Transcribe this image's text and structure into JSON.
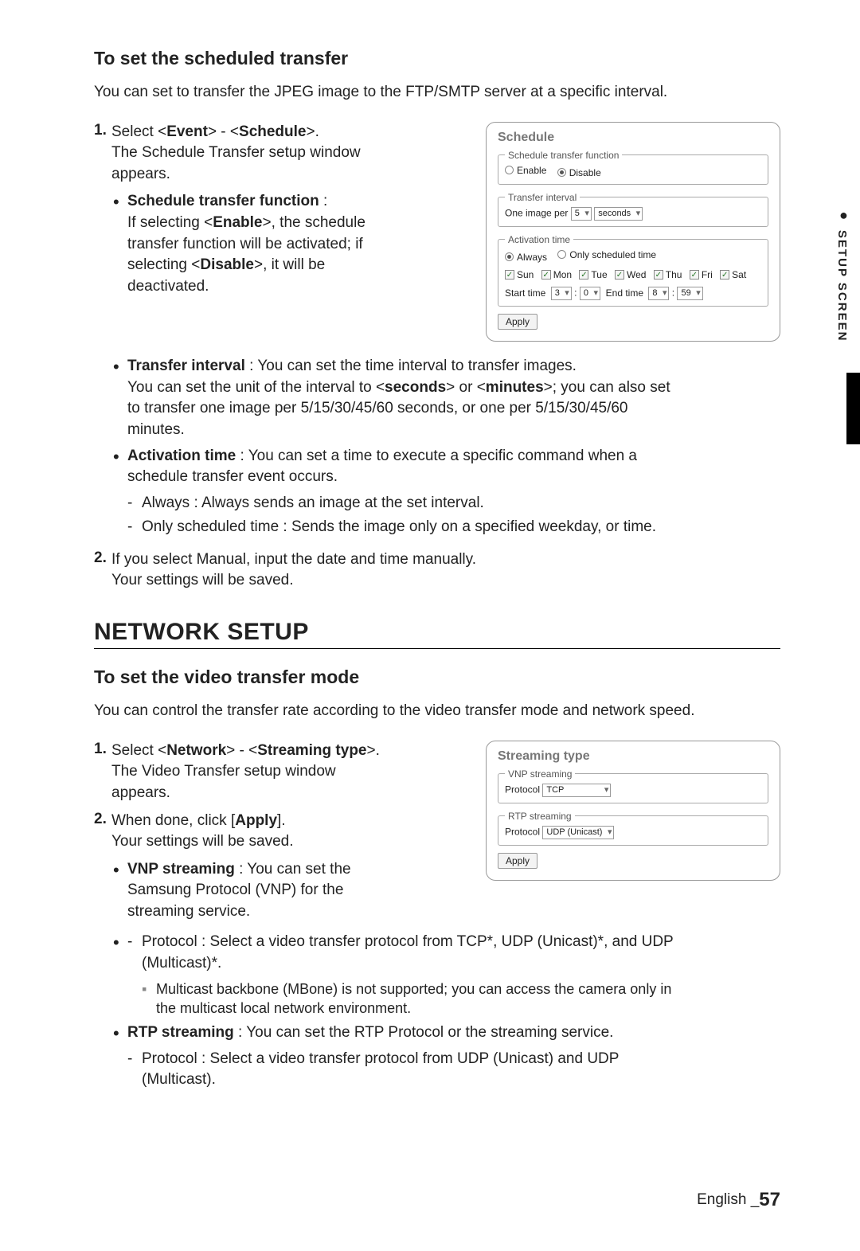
{
  "sideTab": {
    "label": "SETUP SCREEN"
  },
  "section1": {
    "heading": "To set the scheduled transfer",
    "intro": "You can set to transfer the JPEG image to the FTP/SMTP server at a specific interval.",
    "step1": {
      "num": "1.",
      "line1a": "Select <",
      "line1b_bold": "Event",
      "line1c": "> - <",
      "line1d_bold": "Schedule",
      "line1e": ">.",
      "line2": "The Schedule Transfer setup window appears."
    },
    "bullets": {
      "b1_label": "Schedule transfer function",
      "b1_colon": " :",
      "b1_l1a": "If selecting <",
      "b1_l1b": "Enable",
      "b1_l1c": ">, the schedule transfer function will be activated; if selecting <",
      "b1_l1d": "Disable",
      "b1_l1e": ">, it will be deactivated.",
      "b2_label": "Transfer interval",
      "b2_text": " : You can set the time interval to transfer images.",
      "b2_extra_a": "You can set the unit of the interval to <",
      "b2_extra_b": "seconds",
      "b2_extra_c": "> or <",
      "b2_extra_d": "minutes",
      "b2_extra_e": ">; you can also set to transfer one image per 5/15/30/45/60 seconds, or one per 5/15/30/45/60 minutes.",
      "b3_label": "Activation time",
      "b3_text": " : You can set a time to execute a specific command when a schedule transfer event occurs.",
      "b3_d1": "Always : Always sends an image at the set interval.",
      "b3_d2": "Only scheduled time : Sends the image only on a specified weekday, or time."
    },
    "step2": {
      "num": "2.",
      "line1": "If you select Manual, input the date and time manually.",
      "line2": "Your settings will be saved."
    }
  },
  "fig1": {
    "title": "Schedule",
    "g1": {
      "legend": "Schedule transfer function",
      "enable": "Enable",
      "disable": "Disable"
    },
    "g2": {
      "legend": "Transfer interval",
      "prefix": "One image per",
      "val": "5",
      "unit": "seconds"
    },
    "g3": {
      "legend": "Activation time",
      "r1": "Always",
      "r2": "Only scheduled time",
      "days": [
        "Sun",
        "Mon",
        "Tue",
        "Wed",
        "Thu",
        "Fri",
        "Sat"
      ],
      "startLabel": "Start time",
      "sh": "3",
      "sm": "0",
      "endLabel": "End time",
      "eh": "8",
      "em": "59"
    },
    "apply": "Apply"
  },
  "h1": "NETWORK SETUP",
  "section2": {
    "heading": "To set the video transfer mode",
    "intro": "You can control the transfer rate according to the video transfer mode and network speed.",
    "step1": {
      "num": "1.",
      "a": "Select <",
      "b": "Network",
      "c": "> - <",
      "d": "Streaming type",
      "e": ">.",
      "f": "The Video Transfer setup window appears."
    },
    "step2": {
      "num": "2.",
      "a": "When done, click [",
      "b": "Apply",
      "c": "].",
      "d": "Your settings will be saved."
    },
    "bullets": {
      "b1_label": "VNP streaming",
      "b1_text": " : You can set the Samsung Protocol (VNP) for the streaming service.",
      "b1_d1": "Protocol : Select a video transfer protocol from TCP*, UDP (Unicast)*, and UDP (Multicast)*.",
      "b1_note": "Multicast backbone (MBone) is not supported; you can access the camera only in the multicast local network environment.",
      "b2_label": "RTP streaming",
      "b2_text": " : You can set the RTP Protocol or the streaming service.",
      "b2_d1": "Protocol : Select a video transfer protocol from UDP (Unicast) and UDP (Multicast)."
    }
  },
  "fig2": {
    "title": "Streaming type",
    "g1": {
      "legend": "VNP streaming",
      "label": "Protocol",
      "val": "TCP"
    },
    "g2": {
      "legend": "RTP streaming",
      "label": "Protocol",
      "val": "UDP (Unicast)"
    },
    "apply": "Apply"
  },
  "footer": {
    "lang": "English ",
    "sep": "_",
    "page": "57"
  }
}
